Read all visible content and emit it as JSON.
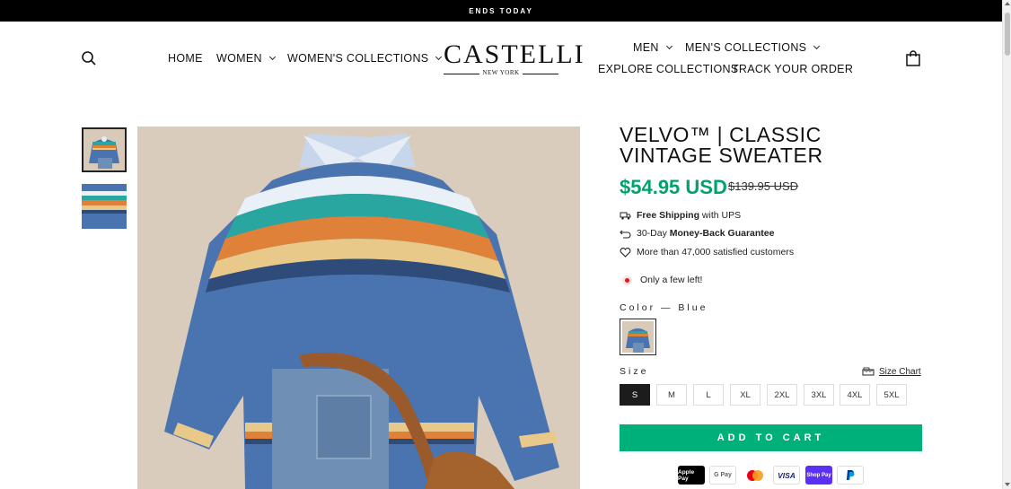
{
  "announcement": "ENDS TODAY",
  "header": {
    "nav_left": [
      "HOME",
      "WOMEN",
      "WOMEN'S COLLECTIONS"
    ],
    "logo_word": "CASTELLI",
    "logo_sub": "NEW YORK",
    "nav_right_row1": [
      "MEN",
      "MEN'S COLLECTIONS"
    ],
    "nav_right_row2": [
      "EXPLORE COLLECTIONS",
      "TRACK YOUR ORDER"
    ]
  },
  "product": {
    "title": "VELVO™ | CLASSIC VINTAGE SWEATER",
    "price": "$54.95 USD",
    "compare_price": "$139.95 USD",
    "features": [
      {
        "icon": "truck-icon",
        "bold": "Free Shipping",
        "text": " with UPS"
      },
      {
        "icon": "return-icon",
        "pre": "30-Day ",
        "bold": "Money-Back Guarantee"
      },
      {
        "icon": "heart-icon",
        "text": "More than 47,000 satisfied customers"
      }
    ],
    "stock_text": "Only a few left!",
    "color_label": "Color — Blue",
    "size_label": "Size",
    "size_chart": "Size Chart",
    "sizes": [
      "S",
      "M",
      "L",
      "XL",
      "2XL",
      "3XL",
      "4XL",
      "5XL"
    ],
    "selected_size": "S",
    "add_to_cart": "ADD TO CART",
    "payments": [
      "Apple Pay",
      "G Pay",
      "Mastercard",
      "VISA",
      "Shop Pay",
      "PayPal"
    ]
  },
  "colors": {
    "accent": "#00b07a",
    "price": "#00a36c",
    "sweater": "#4a74b0"
  }
}
